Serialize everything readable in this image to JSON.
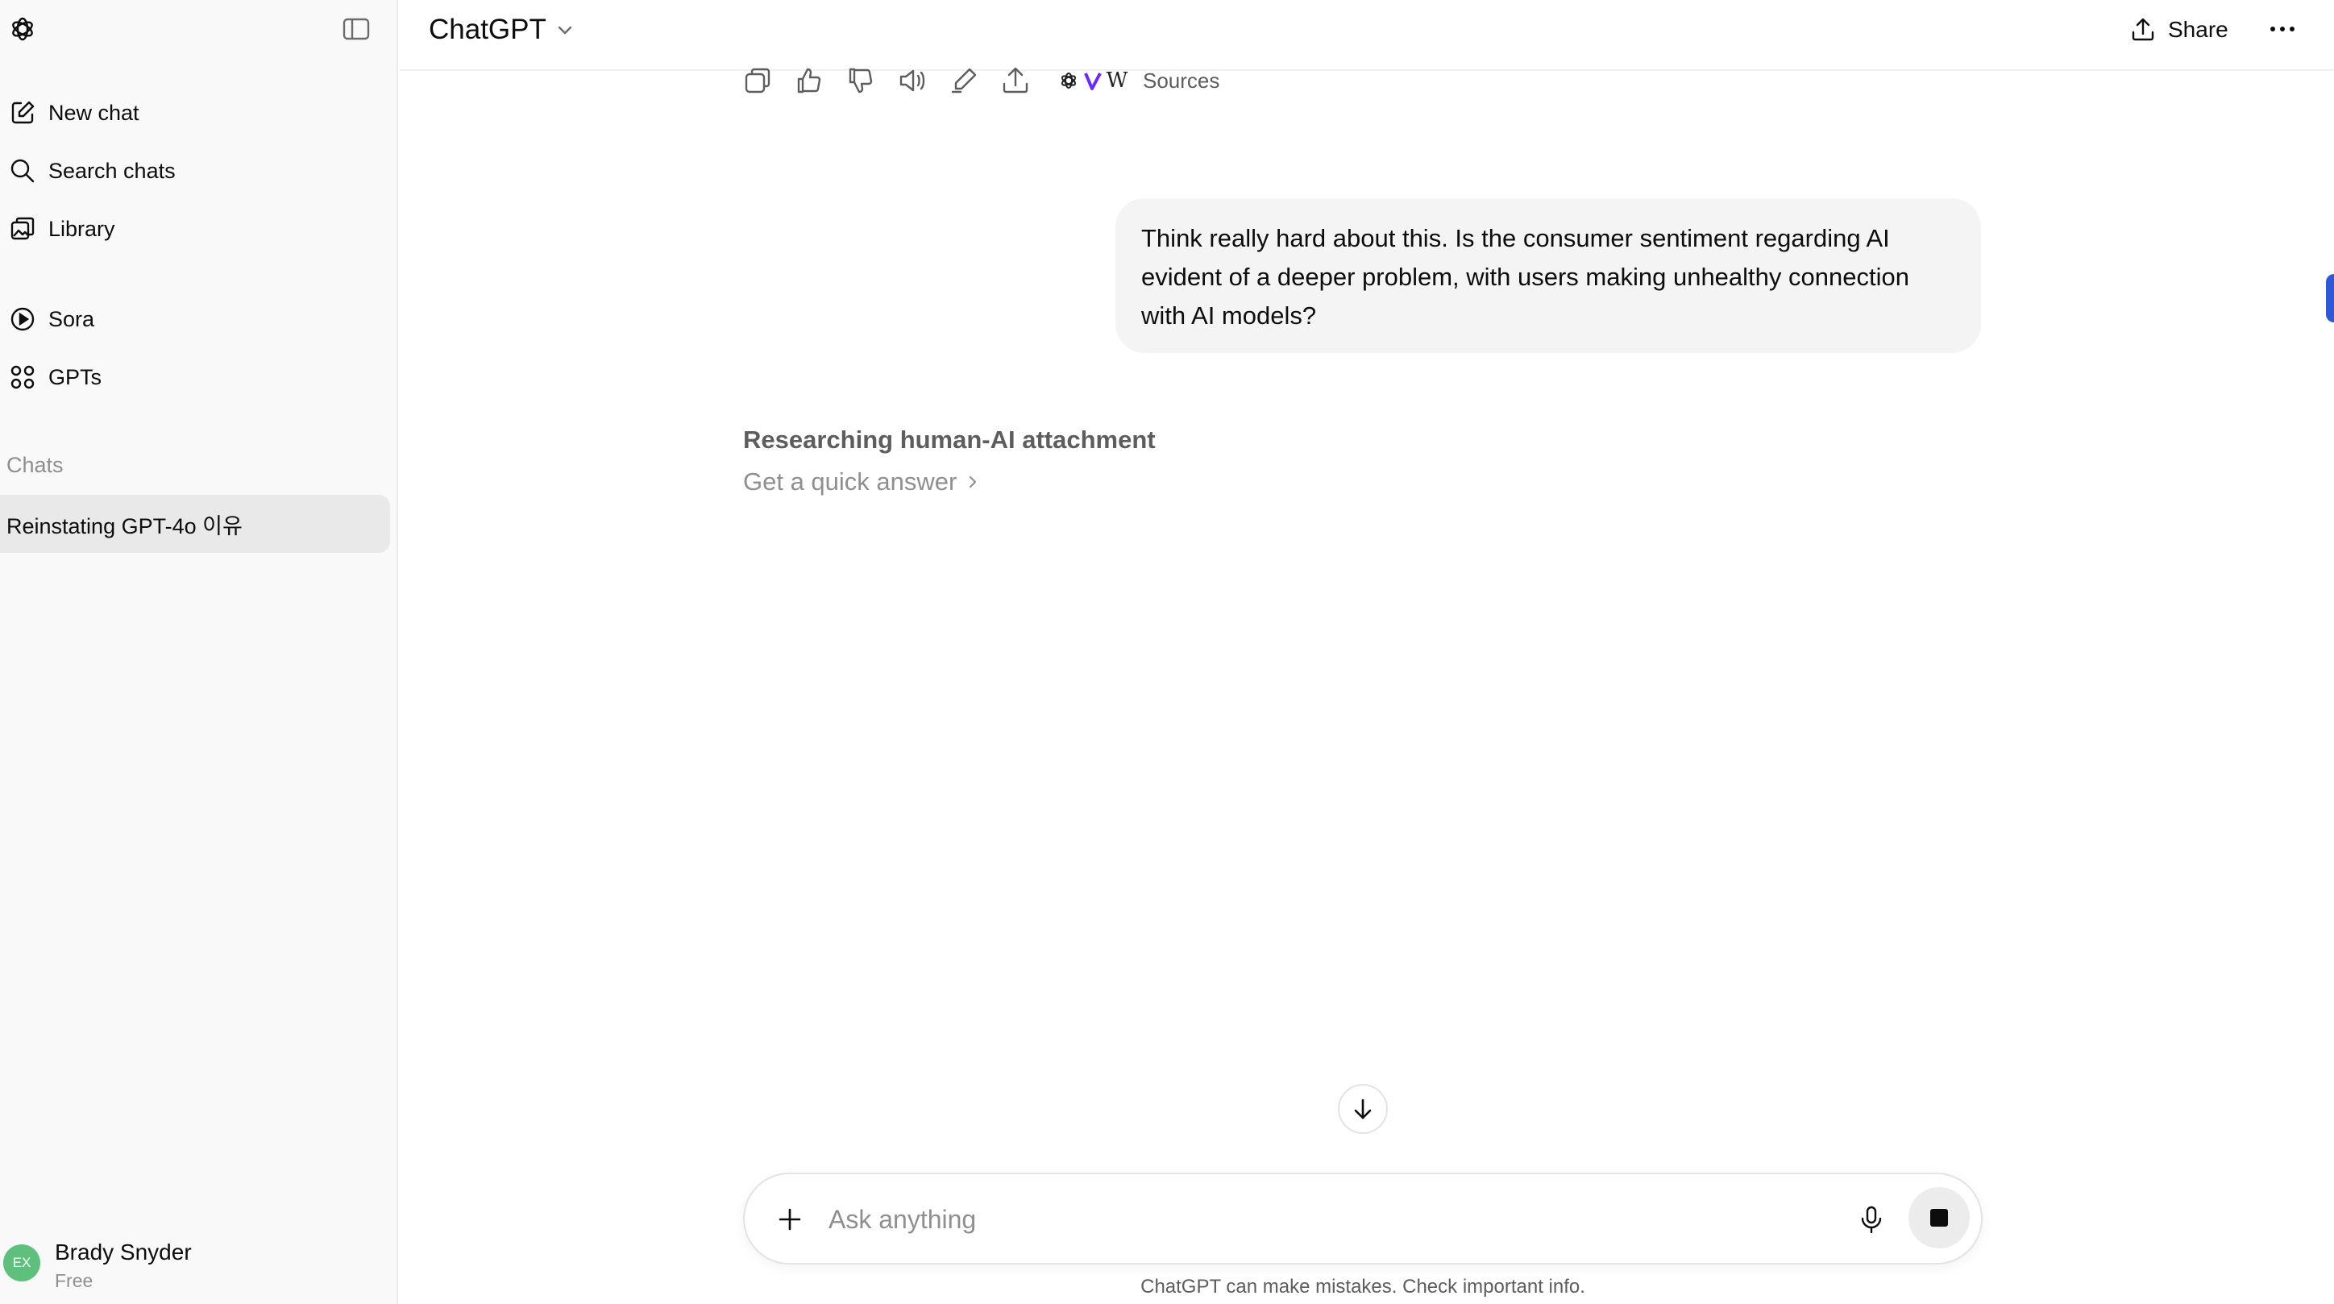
{
  "sidebar": {
    "logo_icon": "openai-logo-icon",
    "toggle_icon": "sidebar-toggle-icon",
    "nav": [
      {
        "label": "New chat",
        "icon": "edit-icon"
      },
      {
        "label": "Search chats",
        "icon": "search-icon"
      },
      {
        "label": "Library",
        "icon": "library-icon"
      },
      {
        "label": "Sora",
        "icon": "play-circle-icon"
      },
      {
        "label": "GPTs",
        "icon": "grid-icon"
      }
    ],
    "chats_label": "Chats",
    "chats": [
      {
        "title": "Reinstating GPT-4o 이유"
      }
    ],
    "user": {
      "initials": "EX",
      "name": "Brady Snyder",
      "plan": "Free",
      "avatar_color": "#5fbf7d"
    }
  },
  "header": {
    "model_label": "ChatGPT",
    "share_label": "Share"
  },
  "actions": {
    "icons": [
      "copy-icon",
      "thumbs-up-icon",
      "thumbs-down-icon",
      "read-aloud-icon",
      "edit-icon",
      "share-icon"
    ],
    "sources_label": "Sources",
    "source_icons": [
      "openai-icon",
      "verge-icon",
      "wikipedia-icon"
    ],
    "source_w": "W"
  },
  "conversation": {
    "user_message": "Think really hard about this. Is the consumer sentiment regarding AI evident of a deeper problem, with users making unhealthy connection with AI models?",
    "status_title": "Researching human-AI attachment",
    "quick_answer_label": "Get a quick answer"
  },
  "composer": {
    "placeholder": "Ask anything",
    "disclaimer": "ChatGPT can make mistakes. Check important info."
  },
  "colors": {
    "sidebar_bg": "#f9f9f9",
    "active_chat_bg": "#e9e9e9",
    "bubble_bg": "#f4f4f4",
    "verge_accent": "#6a2cf5"
  }
}
